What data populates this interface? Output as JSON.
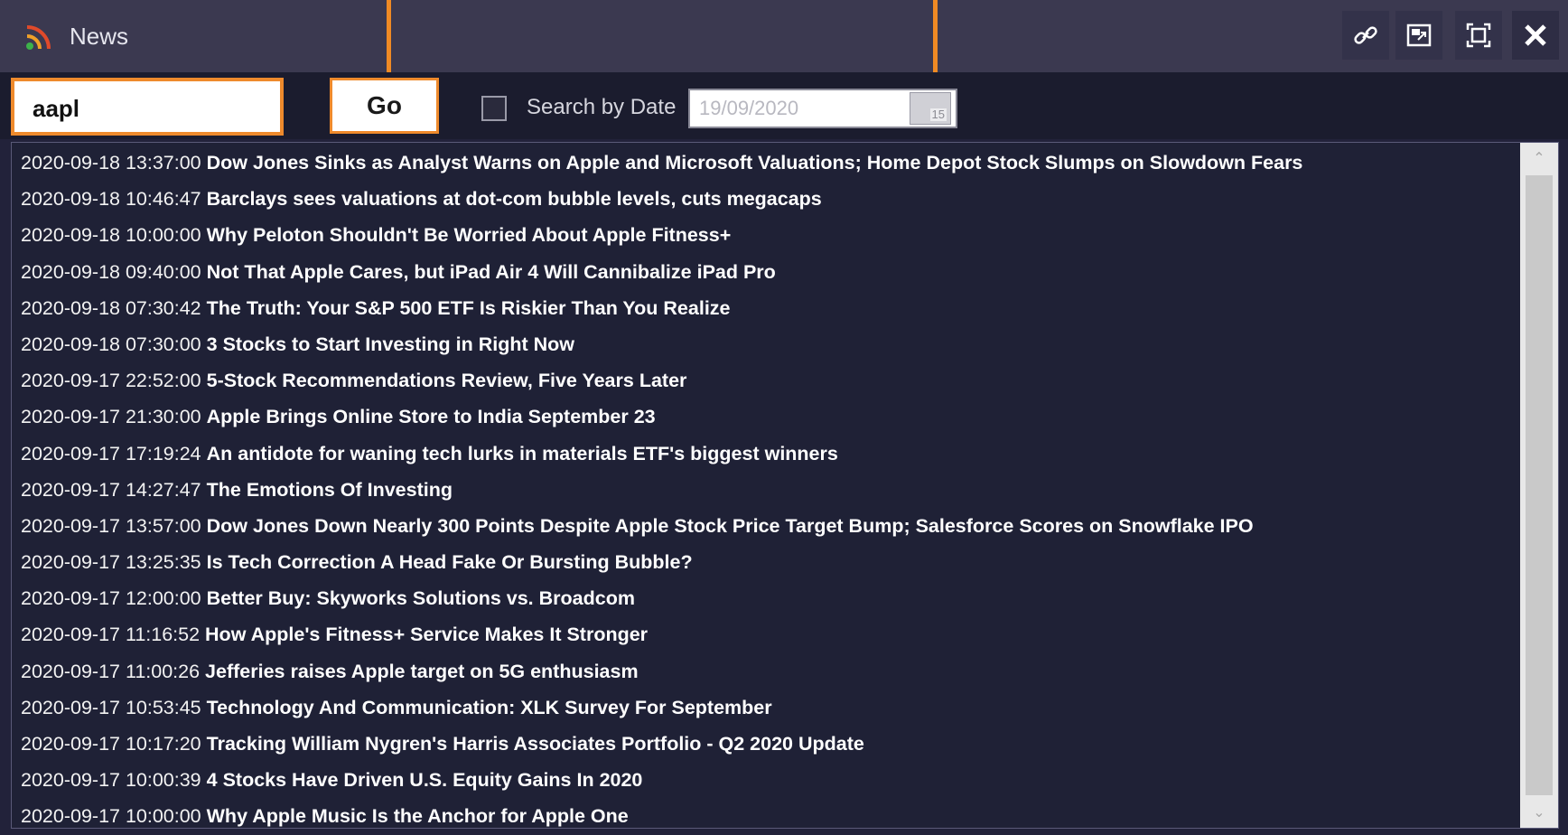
{
  "window": {
    "title": "News",
    "icons": {
      "rss": "rss-icon",
      "link": "link-icon",
      "popout": "popout-icon",
      "maximize": "maximize-icon",
      "close": "close-icon"
    }
  },
  "toolbar": {
    "search_value": "aapl",
    "go_label": "Go",
    "search_by_date_label": "Search by Date",
    "search_by_date_checked": false,
    "date_value": "19/09/2020",
    "calendar_day": "15"
  },
  "news": [
    {
      "time": "2020-09-18 13:37:00",
      "headline": "Dow Jones Sinks as Analyst Warns on Apple and Microsoft Valuations; Home Depot Stock Slumps on Slowdown Fears"
    },
    {
      "time": "2020-09-18 10:46:47",
      "headline": "Barclays sees valuations at dot-com bubble levels, cuts megacaps"
    },
    {
      "time": "2020-09-18 10:00:00",
      "headline": "Why Peloton Shouldn't Be Worried About Apple Fitness+"
    },
    {
      "time": "2020-09-18 09:40:00",
      "headline": "Not That Apple Cares, but iPad Air 4 Will Cannibalize iPad Pro"
    },
    {
      "time": "2020-09-18 07:30:42",
      "headline": "The Truth: Your S&P 500 ETF Is Riskier Than You Realize"
    },
    {
      "time": "2020-09-18 07:30:00",
      "headline": "3 Stocks to Start Investing in Right Now"
    },
    {
      "time": "2020-09-17 22:52:00",
      "headline": "5-Stock Recommendations Review, Five Years Later"
    },
    {
      "time": "2020-09-17 21:30:00",
      "headline": "Apple Brings Online Store to India September 23"
    },
    {
      "time": "2020-09-17 17:19:24",
      "headline": "An antidote for waning tech lurks in materials ETF's biggest winners"
    },
    {
      "time": "2020-09-17 14:27:47",
      "headline": "The Emotions Of Investing"
    },
    {
      "time": "2020-09-17 13:57:00",
      "headline": "Dow Jones Down Nearly 300 Points Despite Apple Stock Price Target Bump; Salesforce Scores on Snowflake IPO"
    },
    {
      "time": "2020-09-17 13:25:35",
      "headline": "Is Tech Correction A Head Fake Or Bursting Bubble?"
    },
    {
      "time": "2020-09-17 12:00:00",
      "headline": "Better Buy: Skyworks Solutions vs. Broadcom"
    },
    {
      "time": "2020-09-17 11:16:52",
      "headline": "How Apple's Fitness+ Service Makes It Stronger"
    },
    {
      "time": "2020-09-17 11:00:26",
      "headline": "Jefferies raises Apple target on 5G enthusiasm"
    },
    {
      "time": "2020-09-17 10:53:45",
      "headline": "Technology And Communication: XLK Survey For September"
    },
    {
      "time": "2020-09-17 10:17:20",
      "headline": "Tracking William Nygren's Harris Associates Portfolio - Q2 2020 Update"
    },
    {
      "time": "2020-09-17 10:00:39",
      "headline": "4 Stocks Have Driven U.S. Equity Gains In 2020"
    },
    {
      "time": "2020-09-17 10:00:00",
      "headline": "Why Apple Music Is the Anchor for Apple One"
    }
  ],
  "colors": {
    "title_bar": "#3b3950",
    "background": "#1f2136",
    "highlight_orange": "#ee8a2c"
  }
}
